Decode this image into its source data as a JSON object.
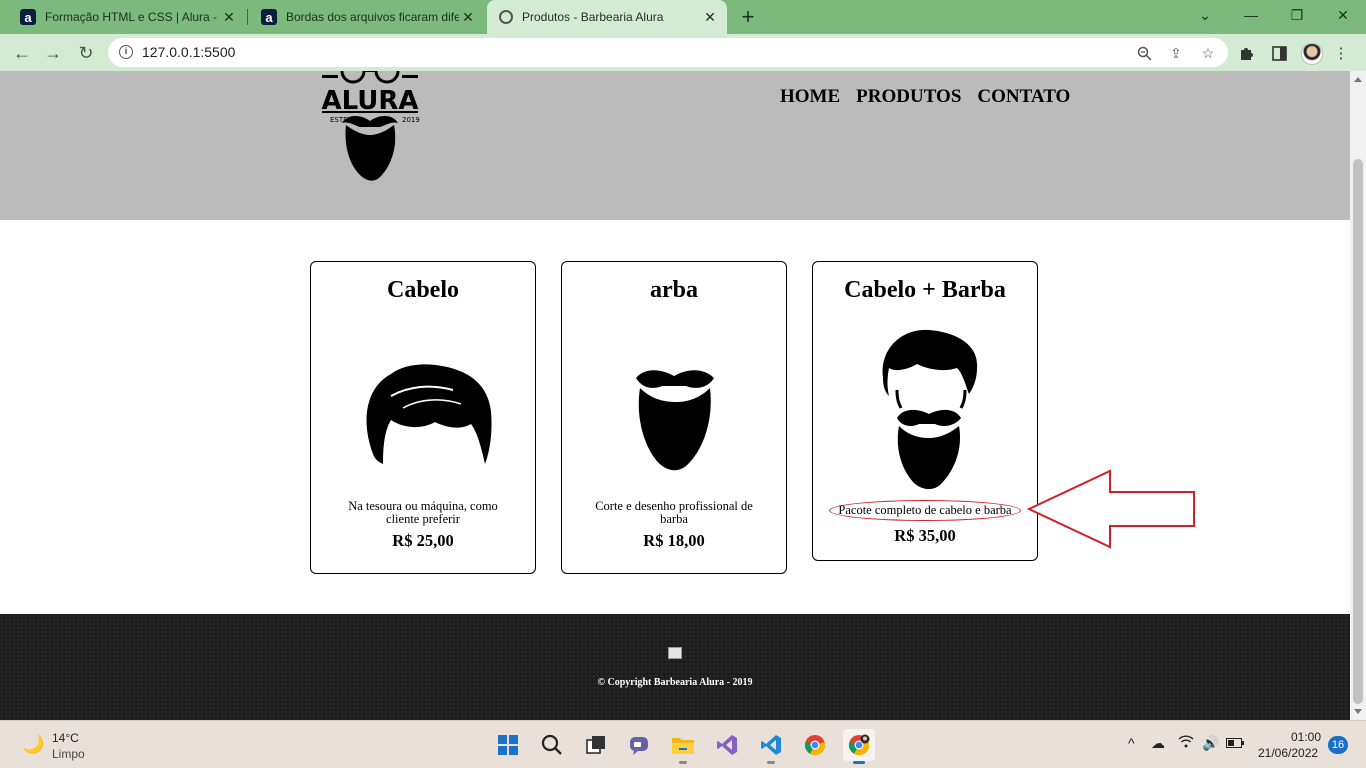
{
  "browser": {
    "tabs": [
      {
        "title": "Formação HTML e CSS | Alura - C",
        "favicon": "a"
      },
      {
        "title": "Bordas dos arquivos ficaram dife",
        "favicon": "a"
      },
      {
        "title": "Produtos - Barbearia Alura",
        "favicon": "globe-icon"
      }
    ],
    "url": "127.0.0.1:5500"
  },
  "site": {
    "nav": [
      "HOME",
      "PRODUTOS",
      "CONTATO"
    ],
    "cards": [
      {
        "title": "Cabelo",
        "description": "Na tesoura ou máquina, como cliente preferir",
        "price": "R$ 25,00"
      },
      {
        "title": "arba",
        "description": "Corte e desenho profissional de barba",
        "price": "R$ 18,00"
      },
      {
        "title": "Cabelo + Barba",
        "description": "Pacote completo de cabelo e barba",
        "price": "R$ 35,00"
      }
    ],
    "footer": {
      "copyright": "© Copyright Barbearia Alura - 2019"
    }
  },
  "taskbar": {
    "weather": {
      "temp": "14°C",
      "desc": "Limpo"
    },
    "time": "01:00",
    "date": "21/06/2022",
    "notifications": "16"
  },
  "colors": {
    "accent_red": "#d11f2b",
    "header_gray": "#bbbbbb",
    "tab_green": "#7cb97c"
  }
}
